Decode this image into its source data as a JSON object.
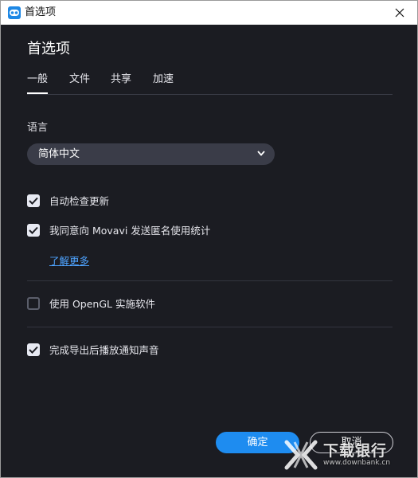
{
  "window": {
    "title": "首选项",
    "icon": "movavi-app-icon",
    "close_icon": "close-icon"
  },
  "page": {
    "heading": "首选项"
  },
  "tabs": [
    {
      "label": "一般",
      "active": true
    },
    {
      "label": "文件",
      "active": false
    },
    {
      "label": "共享",
      "active": false
    },
    {
      "label": "加速",
      "active": false
    }
  ],
  "language": {
    "label": "语言",
    "selected": "简体中文",
    "icon": "chevron-down-icon"
  },
  "options": {
    "auto_update": {
      "label": "自动检查更新",
      "checked": true
    },
    "anonymous_stats": {
      "label": "我同意向 Movavi 发送匿名使用统计",
      "checked": true
    },
    "learn_more": "了解更多",
    "opengl": {
      "label": "使用 OpenGL 实施软件",
      "checked": false
    },
    "notify_sound": {
      "label": "完成导出后播放通知声音",
      "checked": true
    }
  },
  "buttons": {
    "ok": "确定",
    "cancel": "取消"
  },
  "watermark": {
    "text": "下载银行",
    "url": "www.downbank.cn"
  },
  "colors": {
    "background": "#1b1c22",
    "accent": "#1e8cf0",
    "link": "#4ea3ff",
    "select_bg": "#3a3c48"
  }
}
